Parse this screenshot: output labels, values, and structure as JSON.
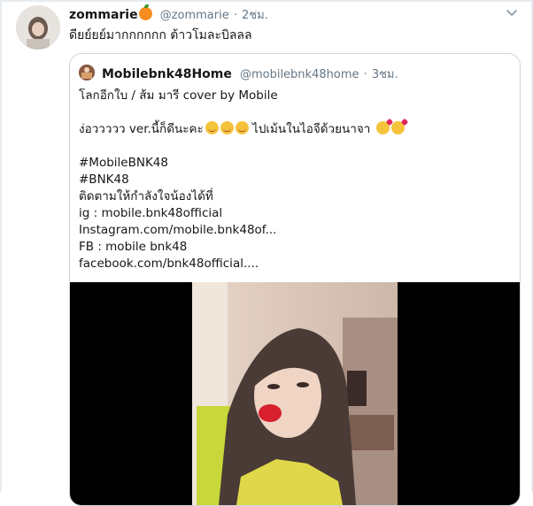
{
  "tweet": {
    "display_name": "zommarie",
    "name_emoji_icon": "tangerine-icon",
    "handle": "@zommarie",
    "separator": "·",
    "time": "2ชม.",
    "text": "ดียย์ยย์มากกกกกก ต้าวโมละบิลลล"
  },
  "quote": {
    "display_name": "Mobilebnk48Home",
    "handle": "@mobilebnk48home",
    "separator": "·",
    "time": "3ชม.",
    "lines": {
      "title": "โลกอีกใบ / ส้ม มารี cover by Mobile",
      "praise": "ง่อววววว ver.นี้ก็ดีนะคะ",
      "praise_suffix": "ไปเม้นในไอจีด้วยนาจา",
      "tag1": "#MobileBNK48",
      "tag2": "#BNK48",
      "follow": "ติดตามให้กำลังใจน้องได้ที่",
      "ig": "ig : mobile.bnk48official",
      "instagram_link": "Instagram.com/mobile.bnk48of...",
      "fb": "FB : mobile bnk48",
      "facebook_link": "facebook.com/bnk48official...."
    },
    "emoji_icons": [
      "smiling-blush-icon",
      "smiling-blush-icon",
      "smiling-blush-icon",
      "face-blowing-kiss-icon",
      "face-blowing-kiss-icon"
    ]
  },
  "colors": {
    "text": "#14171a",
    "muted": "#657786",
    "border": "#ccd6dd",
    "video_bg": "#000000"
  }
}
